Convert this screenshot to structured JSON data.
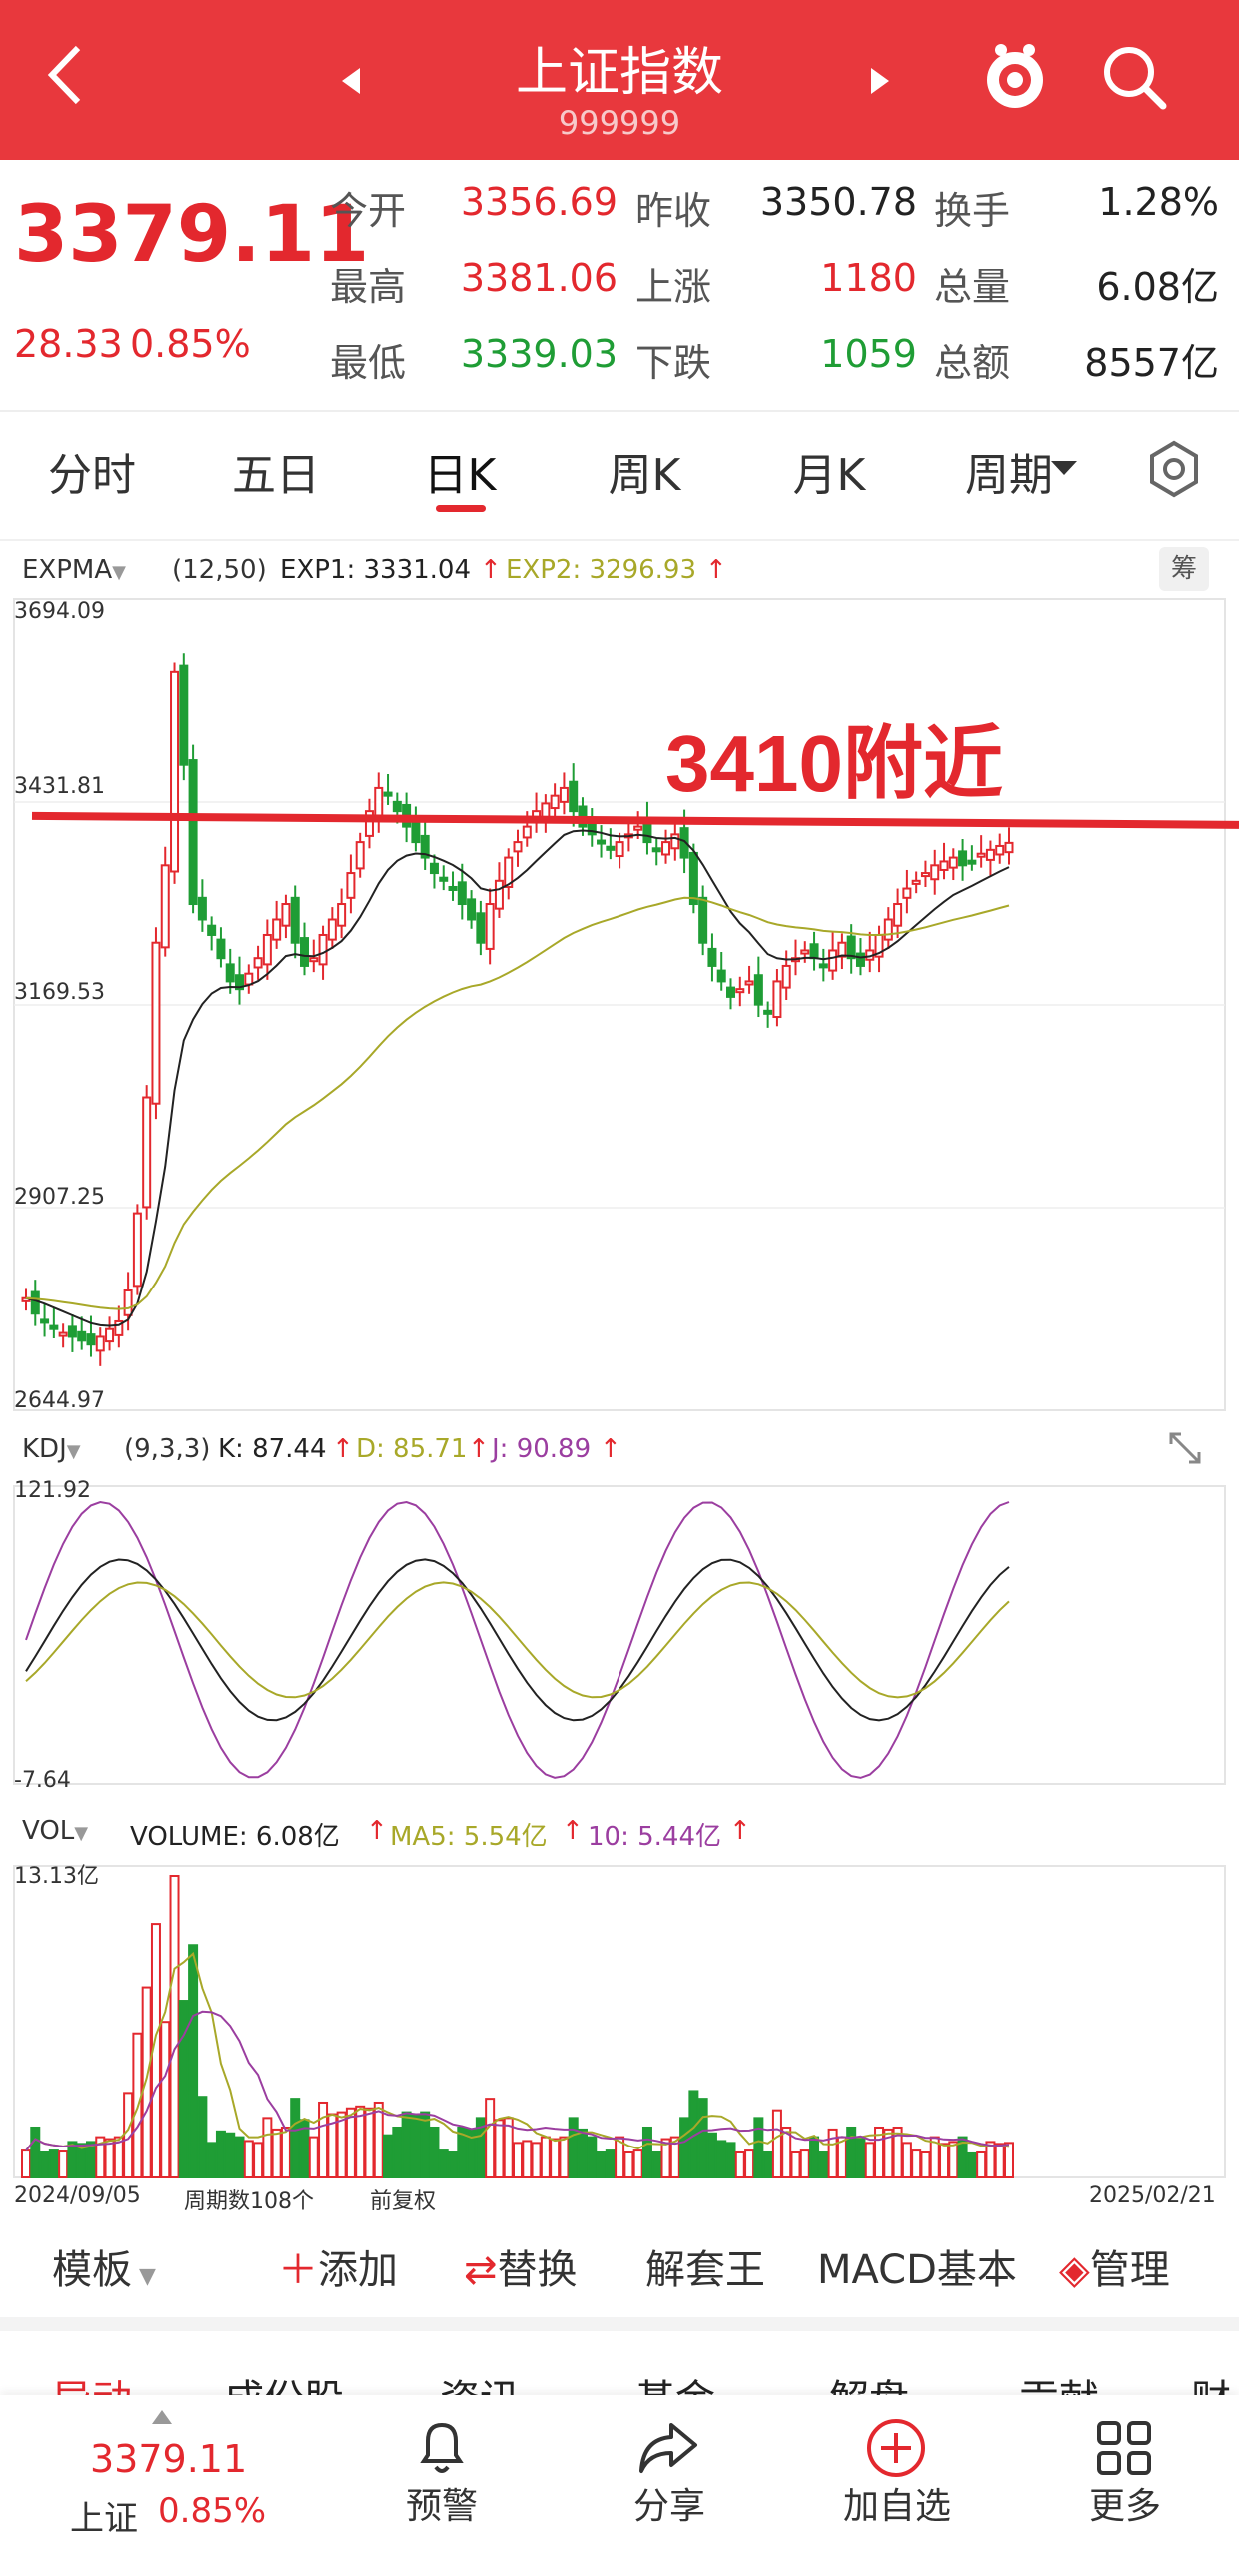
{
  "header": {
    "title": "上证指数",
    "code": "999999"
  },
  "quote": {
    "price": "3379.11",
    "change": "28.33",
    "change_pct": "0.85%",
    "rows": [
      [
        {
          "label": "今开",
          "value": "3356.69",
          "color": "red"
        },
        {
          "label": "昨收",
          "value": "3350.78",
          "color": "dark"
        },
        {
          "label": "换手",
          "value": "1.28%",
          "color": "dark"
        }
      ],
      [
        {
          "label": "最高",
          "value": "3381.06",
          "color": "red"
        },
        {
          "label": "上涨",
          "value": "1180",
          "color": "red"
        },
        {
          "label": "总量",
          "value": "6.08亿",
          "color": "dark"
        }
      ],
      [
        {
          "label": "最低",
          "value": "3339.03",
          "color": "green"
        },
        {
          "label": "下跌",
          "value": "1059",
          "color": "green"
        },
        {
          "label": "总额",
          "value": "8557亿",
          "color": "dark"
        }
      ]
    ]
  },
  "tabs": [
    {
      "label": "分时"
    },
    {
      "label": "五日"
    },
    {
      "label": "日K"
    },
    {
      "label": "周K"
    },
    {
      "label": "月K"
    },
    {
      "label": "周期"
    }
  ],
  "active_tab": 2,
  "price_panel": {
    "indicator": "EXPMA",
    "params": "(12,50)",
    "exp1": "EXP1: 3331.04",
    "exp2": "EXP2: 3296.93",
    "settings_label": "筹",
    "annotation": "3410附近",
    "y_labels": [
      "3694.09",
      "3431.81",
      "3169.53",
      "2907.25",
      "2644.97"
    ]
  },
  "kdj_panel": {
    "indicator": "KDJ",
    "params": "(9,3,3)",
    "k": "K: 87.44",
    "d": "D: 85.71",
    "j": "J: 90.89",
    "y_top": "121.92",
    "y_bottom": "-7.64"
  },
  "vol_panel": {
    "indicator": "VOL",
    "volume": "VOLUME: 6.08亿",
    "ma5": "MA5: 5.54亿",
    "ma10": "10: 5.44亿",
    "y_top": "13.13亿"
  },
  "axis": {
    "start": "2024/09/05",
    "count": "周期数108个",
    "adjust": "前复权",
    "end": "2025/02/21"
  },
  "toolbar": {
    "template": "模板",
    "add": "添加",
    "replace": "替换",
    "unlock": "解套王",
    "macd": "MACD基本",
    "manage": "管理"
  },
  "news_tabs": [
    "异动",
    "成份股",
    "资讯",
    "基金",
    "解盘",
    "贡献",
    "财"
  ],
  "bottom": {
    "price": "3379.11",
    "name": "上证",
    "pct": "0.85%",
    "items": [
      "预警",
      "分享",
      "加自选",
      "更多"
    ]
  },
  "colors": {
    "red": "#e3282e",
    "green": "#1f9d35",
    "header": "#e8383d",
    "exp2": "#a8a829",
    "j": "#9b3ea0"
  },
  "chart_data": {
    "type": "candlestick",
    "x_range": [
      "2024/09/05",
      "2025/02/21"
    ],
    "ylim": [
      2644.97,
      3694.09
    ],
    "reference_line": 3410,
    "close": [
      2790,
      2770,
      2760,
      2750,
      2745,
      2740,
      2735,
      2730,
      2740,
      2750,
      2760,
      2800,
      2900,
      3050,
      3250,
      3350,
      3600,
      3480,
      3300,
      3280,
      3260,
      3230,
      3200,
      3190,
      3210,
      3230,
      3260,
      3280,
      3300,
      3250,
      3220,
      3230,
      3260,
      3280,
      3300,
      3340,
      3380,
      3420,
      3450,
      3440,
      3420,
      3400,
      3380,
      3360,
      3340,
      3330,
      3320,
      3300,
      3280,
      3250,
      3300,
      3330,
      3360,
      3380,
      3400,
      3420,
      3430,
      3440,
      3450,
      3420,
      3400,
      3390,
      3380,
      3370,
      3380,
      3390,
      3400,
      3380,
      3370,
      3380,
      3390,
      3360,
      3300,
      3250,
      3220,
      3200,
      3180,
      3190,
      3200,
      3170,
      3160,
      3200,
      3220,
      3230,
      3240,
      3230,
      3220,
      3240,
      3250,
      3230,
      3220,
      3240,
      3260,
      3280,
      3300,
      3320,
      3330,
      3340,
      3350,
      3355,
      3360,
      3350,
      3355,
      3365,
      3370,
      3375,
      3379
    ],
    "exp1_end": 3331.04,
    "exp2_end": 3296.93,
    "kdj_range": [
      -7.64,
      121.92
    ],
    "kdj_end": {
      "k": 87.44,
      "d": 85.71,
      "j": 90.89
    },
    "vol_max": "13.13亿",
    "vol_last": "6.08亿"
  }
}
